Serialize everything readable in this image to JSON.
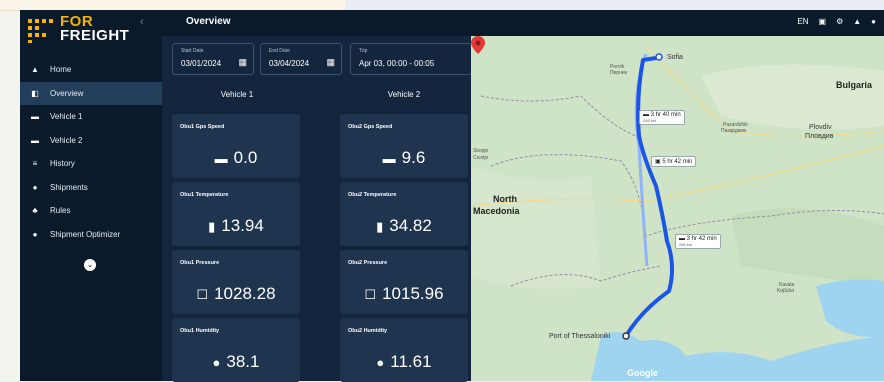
{
  "sidebar": {
    "logo_top": "FOR",
    "logo_bottom": "FREIGHT",
    "collapse_glyph": "‹",
    "items": [
      {
        "label": "Home",
        "icon": "home-icon",
        "glyph": "▲",
        "active": false
      },
      {
        "label": "Overview",
        "icon": "overview-icon",
        "glyph": "◧",
        "active": true
      },
      {
        "label": "Vehicle 1",
        "icon": "car-icon",
        "glyph": "▬",
        "active": false
      },
      {
        "label": "Vehicle 2",
        "icon": "car-icon",
        "glyph": "▬",
        "active": false
      },
      {
        "label": "History",
        "icon": "history-icon",
        "glyph": "≡",
        "active": false
      },
      {
        "label": "Shipments",
        "icon": "shipments-icon",
        "glyph": "●",
        "active": false
      },
      {
        "label": "Rules",
        "icon": "rules-icon",
        "glyph": "♣",
        "active": false
      },
      {
        "label": "Shipment Optimizer",
        "icon": "optimizer-icon",
        "glyph": "●",
        "active": false
      }
    ],
    "toggle_glyph": "⌄"
  },
  "header": {
    "title": "Overview",
    "language": "EN",
    "icons": [
      "document-icon",
      "settings-icon",
      "notification-icon",
      "account-icon"
    ]
  },
  "filters": {
    "start_label": "Start Date",
    "start_value": "03/01/2024",
    "end_label": "End Date",
    "end_value": "03/04/2024",
    "trip_label": "Trip",
    "trip_value": "Apr 03, 00:00 - 00:05"
  },
  "vehicles": [
    {
      "title": "Vehicle 1",
      "cards": [
        {
          "label": "Obu1 Gps Speed",
          "value": "0.0",
          "icon": "car-icon",
          "glyph": "🚘"
        },
        {
          "label": "Obu1 Temperature",
          "value": "13.94",
          "icon": "thermometer-icon",
          "glyph": "🌡"
        },
        {
          "label": "Obu1 Pressure",
          "value": "1028.28",
          "icon": "pressure-icon",
          "glyph": "☐"
        },
        {
          "label": "Obu1 Humidity",
          "value": "38.1",
          "icon": "droplet-icon",
          "glyph": "💧"
        }
      ]
    },
    {
      "title": "Vehicle 2",
      "cards": [
        {
          "label": "Obu2 Gps Speed",
          "value": "9.6",
          "icon": "car-icon",
          "glyph": "🚘"
        },
        {
          "label": "Obu2 Temperature",
          "value": "34.82",
          "icon": "thermometer-icon",
          "glyph": "🌡"
        },
        {
          "label": "Obu2 Pressure",
          "value": "1015.96",
          "icon": "pressure-icon",
          "glyph": "☐"
        },
        {
          "label": "Obu2 Humidity",
          "value": "11.61",
          "icon": "droplet-icon",
          "glyph": "💧"
        }
      ]
    }
  ],
  "map": {
    "labels": {
      "sofia": "Sofia",
      "pernik": "Pernik",
      "pernik_local": "Перник",
      "bulgaria": "Bulgaria",
      "skopje": "Skopje",
      "skopje_local": "Скопје",
      "north_macedonia_1": "North",
      "north_macedonia_2": "Macedonia",
      "pazardzhik": "Pazardzhik",
      "pazardzhik_local": "Пазарджик",
      "plovdiv": "Plovdiv",
      "plovdiv_local": "Пловдив",
      "port": "Port of Thessaloniki",
      "kavala": "Kavala",
      "kavala_local": "Καβάλα",
      "google": "Google"
    },
    "routes": [
      {
        "time": "3 hr 40 min",
        "distance": "256 km"
      },
      {
        "time": "5 hr 42 min",
        "distance": ""
      },
      {
        "time": "3 hr 42 min",
        "distance": "266 km"
      }
    ],
    "colors": {
      "route_primary": "#1a55e8",
      "route_alt": "#8fb3f5",
      "water": "#9fd4f0",
      "land": "#cfe3c7"
    }
  }
}
